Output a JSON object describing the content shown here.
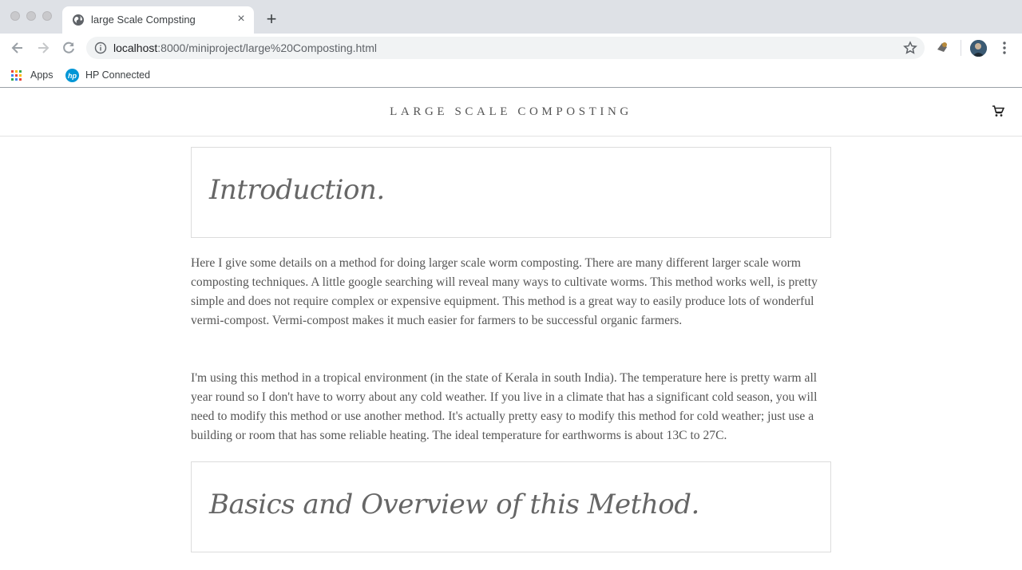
{
  "browser": {
    "tab_title": "large Scale Compsting",
    "tab_close": "×",
    "new_tab": "+",
    "url_host": "localhost",
    "url_path": ":8000/miniproject/large%20Composting.html",
    "bookmarks": [
      {
        "label": "Apps",
        "icon": "apps-grid-icon"
      },
      {
        "label": "HP Connected",
        "icon": "hp-logo-icon"
      }
    ]
  },
  "site": {
    "title": "LARGE SCALE COMPOSTING",
    "cart_icon": "cart-icon"
  },
  "article": {
    "heading1": "Introduction.",
    "para1": "Here I give some details on a method for doing larger scale worm composting. There are many different larger scale worm composting techniques. A little google searching will reveal many ways to cultivate worms. This method works well, is pretty simple and does not require complex or expensive equipment. This method is a great way to easily produce lots of wonderful vermi-compost. Vermi-compost makes it much easier for farmers to be successful organic farmers.",
    "para2": "I'm using this method in a tropical environment (in the state of Kerala in south India). The temperature here is pretty warm all year round so I don't have to worry about any cold weather. If you live in a climate that has a significant cold season, you will need to modify this method or use another method. It's actually pretty easy to modify this method for cold weather; just use a building or room that has some reliable heating. The ideal temperature for earthworms is about 13C to 27C.",
    "heading2": "Basics and Overview of this Method."
  }
}
